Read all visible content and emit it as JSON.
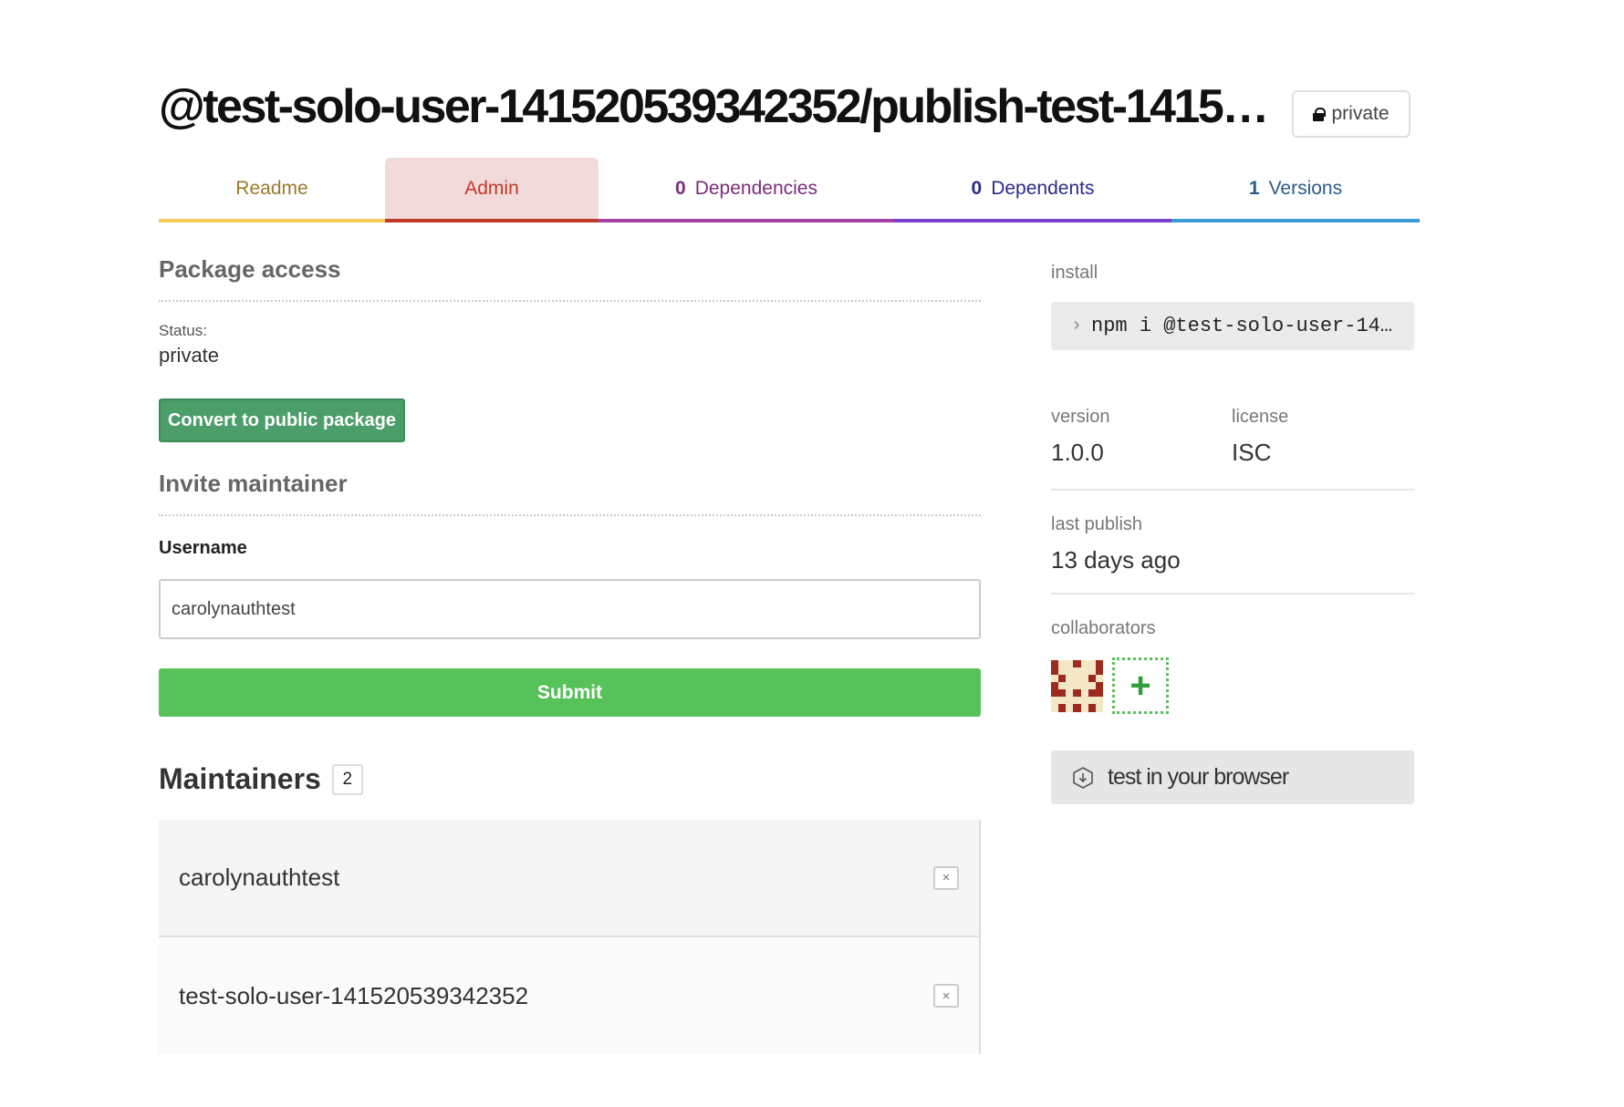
{
  "header": {
    "package_name": "@test-solo-user-141520539342352/publish-test-14152053…",
    "visibility_badge": "private",
    "badge_icon": "lock-icon"
  },
  "tabs": [
    {
      "label": "Readme",
      "count": ""
    },
    {
      "label": "Admin",
      "count": ""
    },
    {
      "label": "Dependencies",
      "count": "0"
    },
    {
      "label": "Dependents",
      "count": "0"
    },
    {
      "label": "Versions",
      "count": "1"
    }
  ],
  "active_tab": "Admin",
  "package_access": {
    "title": "Package access",
    "status_label": "Status:",
    "status_value": "private",
    "convert_button": "Convert to public package"
  },
  "invite": {
    "title": "Invite maintainer",
    "username_label": "Username",
    "username_value": "carolynauthtest",
    "submit_button": "Submit"
  },
  "maintainers": {
    "title": "Maintainers",
    "count": "2",
    "list": [
      {
        "name": "carolynauthtest",
        "remove": "×"
      },
      {
        "name": "test-solo-user-141520539342352",
        "remove": "×"
      }
    ]
  },
  "sidebar": {
    "install_label": "install",
    "install_prompt": "›",
    "install_command": "npm i @test-solo-user-14…",
    "version_label": "version",
    "version_value": "1.0.0",
    "license_label": "license",
    "license_value": "ISC",
    "last_publish_label": "last publish",
    "last_publish_value": "13 days ago",
    "collaborators_label": "collaborators",
    "add_collaborator": "+",
    "browser_button": "test in your browser"
  },
  "colors": {
    "readme": "#f2cb5a",
    "admin": "#c0392b",
    "dependencies": "#a440a6",
    "dependents": "#7a40cc",
    "versions": "#3a9bd6",
    "convert_button": "#4b9e6a",
    "submit_button": "#57c15a"
  }
}
